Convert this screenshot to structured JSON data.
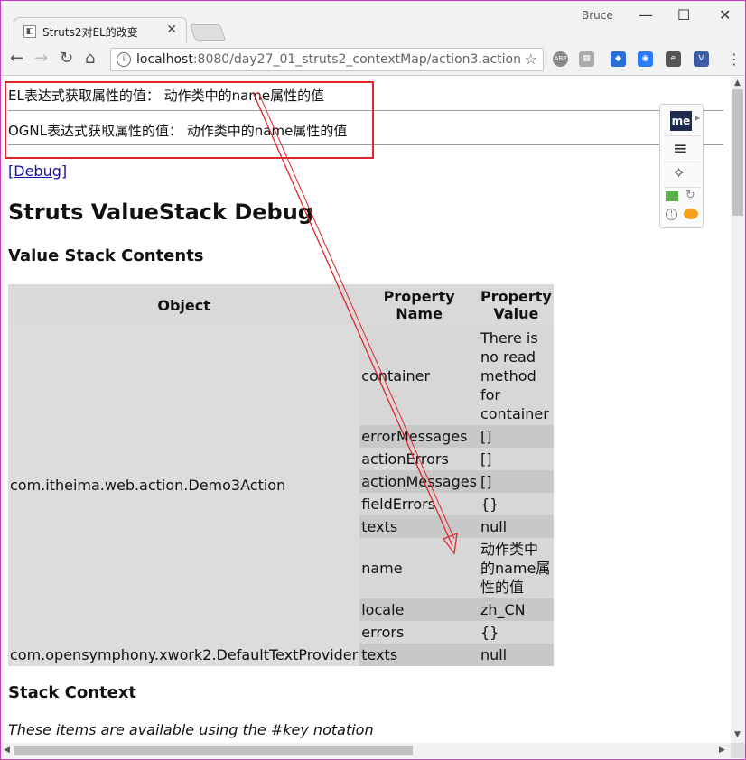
{
  "browser": {
    "tab_title": "Struts2对EL的改变",
    "user_name": "Bruce",
    "url_host": "localhost",
    "url_rest": ":8080/day27_01_struts2_contextMap/action3.action",
    "ext_abp": "ABP"
  },
  "page": {
    "el_line": "EL表达式获取属性的值： 动作类中的name属性的值",
    "ognl_line": "OGNL表达式获取属性的值： 动作类中的name属性的值",
    "debug_link": "[Debug]",
    "heading": "Struts ValueStack Debug",
    "subheading_vs": "Value Stack Contents",
    "table_headers": {
      "object": "Object",
      "property_name": "Property Name",
      "property_value": "Property Value"
    },
    "rows": [
      {
        "object": "com.itheima.web.action.Demo3Action",
        "props": [
          {
            "name": "container",
            "value": "There is no read method for container"
          },
          {
            "name": "errorMessages",
            "value": "[]"
          },
          {
            "name": "actionErrors",
            "value": "[]"
          },
          {
            "name": "actionMessages",
            "value": "[]"
          },
          {
            "name": "fieldErrors",
            "value": "{}"
          },
          {
            "name": "texts",
            "value": "null"
          },
          {
            "name": "name",
            "value": "动作类中的name属性的值"
          },
          {
            "name": "locale",
            "value": "zh_CN"
          },
          {
            "name": "errors",
            "value": "{}"
          }
        ]
      },
      {
        "object": "com.opensymphony.xwork2.DefaultTextProvider",
        "props": [
          {
            "name": "texts",
            "value": "null"
          }
        ]
      }
    ],
    "subheading_ctx": "Stack Context",
    "ctx_note": "These items are available using the #key notation"
  },
  "panel": {
    "me_logo": "me"
  },
  "colors": {
    "annotation_red": "#e0262d",
    "link": "#1a0dab",
    "frame": "#c43bbd"
  }
}
